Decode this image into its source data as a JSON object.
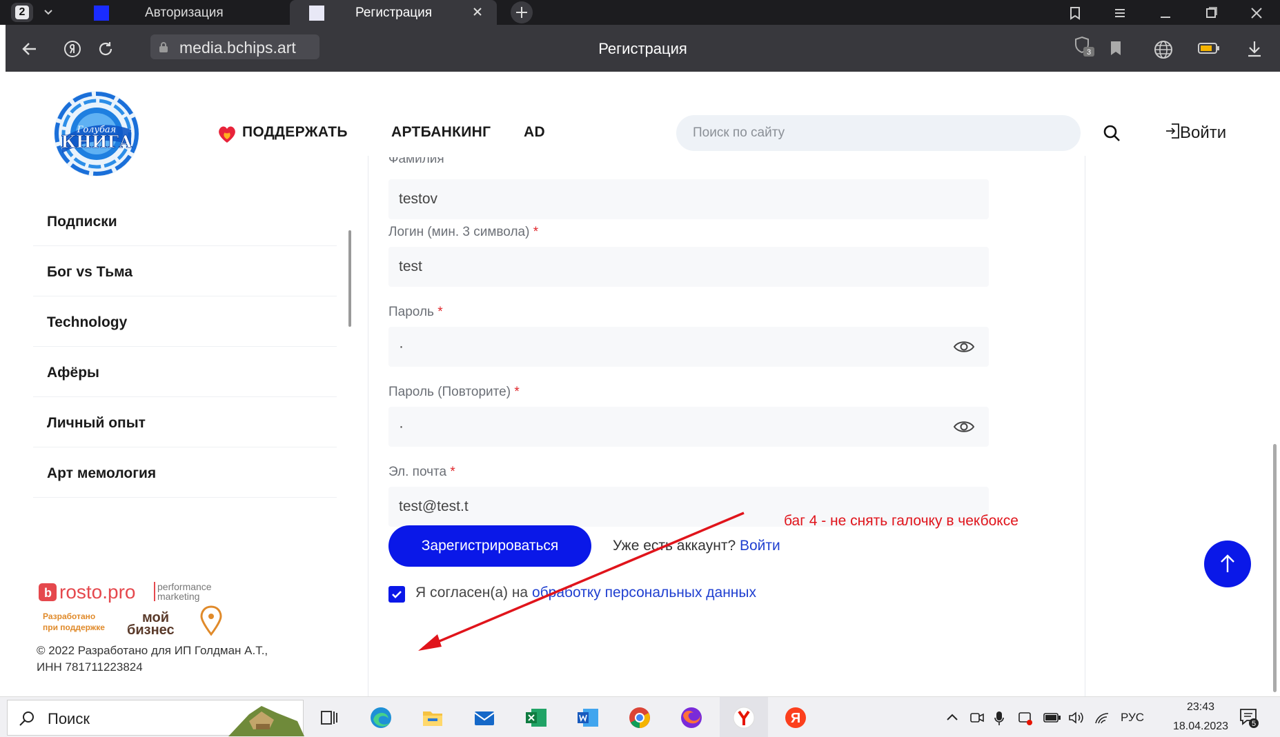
{
  "browser": {
    "tab_count": "2",
    "tabs": [
      {
        "label": "Авторизация"
      },
      {
        "label": "Регистрация"
      }
    ],
    "url": "media.bchips.art",
    "page_title": "Регистрация",
    "shield_count": "3"
  },
  "site": {
    "nav": [
      "ПОДДЕРЖАТЬ",
      "АРТБАНКИНГ",
      "AD"
    ],
    "search_placeholder": "Поиск по сайту",
    "login_label": "Войти"
  },
  "sidebar": {
    "items": [
      "Подписки",
      "Бог vs Тьма",
      "Technology",
      "Афёры",
      "Личный опыт",
      "Арт мемология"
    ],
    "partner_rosto": "rosto.pro",
    "partner_rosto_sub1": "performance",
    "partner_rosto_sub2": "marketing",
    "partner_support1": "Разработано",
    "partner_support2": "при поддержке",
    "partner_moy1": "мой",
    "partner_moy2": "бизнес",
    "copyright_line1": "© 2022 Разработано для ИП Голдман А.Т.,",
    "copyright_line2": "ИНН 781711223824"
  },
  "form": {
    "cut_label": "Фамилия",
    "surname_value": "testov",
    "login_label": "Логин (мин. 3 символа)",
    "login_value": "test",
    "password_label": "Пароль",
    "password_value": "·",
    "password_repeat_label": "Пароль (Повторите)",
    "password_repeat_value": "·",
    "email_label": "Эл. почта",
    "email_value": "test@test.t",
    "required_mark": "*",
    "register_button": "Зарегистрироваться",
    "have_account": "Уже есть аккаунт?",
    "have_account_link": "Войти",
    "agree_text": "Я согласен(а) на",
    "agree_link": "обработку персональных данных",
    "agree_checked": true
  },
  "annotation": {
    "bug_note": "баг 4 - не снять галочку в чекбоксе",
    "color": "#e0141b"
  },
  "taskbar": {
    "search_label": "Поиск",
    "language": "РУС",
    "time": "23:43",
    "date": "18.04.2023",
    "notifications": "5"
  },
  "colors": {
    "accent_blue": "#0a18e8",
    "link_blue": "#1f3fd0",
    "required_red": "#e0262b",
    "browser_dark": "#38383d"
  }
}
